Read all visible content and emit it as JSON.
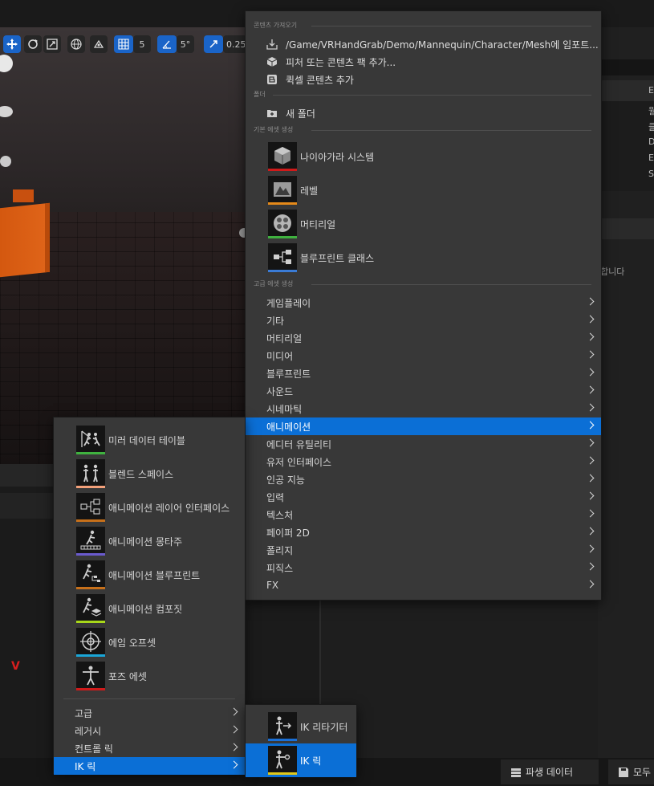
{
  "main_menu": {
    "sections": {
      "import": "콘텐츠 가져오기",
      "folder": "폴더",
      "basic": "기본 에셋 생성",
      "advanced": "고급 에셋 생성"
    },
    "import_items": [
      {
        "label": "/Game/VRHandGrab/Demo/Mannequin/Character/Mesh에 임포트...",
        "icon": "import-icon"
      },
      {
        "label": "피처 또는 콘텐츠 팩 추가...",
        "icon": "feature-pack-icon"
      },
      {
        "label": "퀵셀 콘텐츠 추가",
        "icon": "quixel-icon"
      }
    ],
    "folder_items": [
      {
        "label": "새 폴더",
        "icon": "new-folder-icon"
      }
    ],
    "basic_assets": [
      {
        "label": "나이아가라 시스템",
        "icon": "niagara-icon",
        "color": "#d01a1a"
      },
      {
        "label": "레벨",
        "icon": "level-icon",
        "color": "#e58a1a"
      },
      {
        "label": "머티리얼",
        "icon": "material-icon",
        "color": "#3fb23f"
      },
      {
        "label": "블루프린트 클래스",
        "icon": "blueprint-icon",
        "color": "#3a7bd5"
      }
    ],
    "categories": [
      {
        "label": "게임플레이"
      },
      {
        "label": "기타"
      },
      {
        "label": "머티리얼"
      },
      {
        "label": "미디어"
      },
      {
        "label": "블루프린트"
      },
      {
        "label": "사운드"
      },
      {
        "label": "시네마틱"
      },
      {
        "label": "애니메이션",
        "active": true
      },
      {
        "label": "에디터 유틸리티"
      },
      {
        "label": "유저 인터페이스"
      },
      {
        "label": "인공 지능"
      },
      {
        "label": "입력"
      },
      {
        "label": "텍스처"
      },
      {
        "label": "페이퍼 2D"
      },
      {
        "label": "폴리지"
      },
      {
        "label": "피직스"
      },
      {
        "label": "FX"
      }
    ]
  },
  "animation_menu": {
    "assets": [
      {
        "label": "미러 데이터 테이블",
        "icon": "mirror-data-table-icon",
        "color": "#3fb23f"
      },
      {
        "label": "블렌드 스페이스",
        "icon": "blend-space-icon",
        "color": "#f2a07a"
      },
      {
        "label": "애니메이션 레이어 인터페이스",
        "icon": "anim-layer-interface-icon",
        "color": "#c7701a"
      },
      {
        "label": "애니메이션 몽타주",
        "icon": "anim-montage-icon",
        "color": "#6a5acd"
      },
      {
        "label": "애니메이션 블루프린트",
        "icon": "anim-blueprint-icon",
        "color": "#c7701a"
      },
      {
        "label": "애니메이션 컴포짓",
        "icon": "anim-composite-icon",
        "color": "#a8d81a"
      },
      {
        "label": "에임 오프셋",
        "icon": "aim-offset-icon",
        "color": "#1aa6d8"
      },
      {
        "label": "포즈 에셋",
        "icon": "pose-asset-icon",
        "color": "#d01a1a"
      }
    ],
    "submenus": [
      {
        "label": "고급"
      },
      {
        "label": "레거시"
      },
      {
        "label": "컨트롤 릭"
      },
      {
        "label": "IK 릭",
        "active": true
      }
    ]
  },
  "ik_menu": {
    "assets": [
      {
        "label": "IK 리타기터",
        "icon": "ik-retargeter-icon",
        "color": "#1a6fd6"
      },
      {
        "label": "IK 릭",
        "icon": "ik-rig-icon",
        "color": "#e0c81a",
        "active": true
      }
    ]
  },
  "viewport_toolbar": {
    "grid_snap": "5",
    "angle_snap": "5°",
    "scale_snap": "0.25"
  },
  "right_panel": {
    "message_fragment": "합니다",
    "column_letters": [
      "E",
      "월",
      "클",
      "D",
      "E",
      "S"
    ]
  },
  "status_bar": {
    "derived_data": "파생 데이터",
    "save_all": "모두"
  },
  "background": {
    "red_glyph": "V"
  }
}
